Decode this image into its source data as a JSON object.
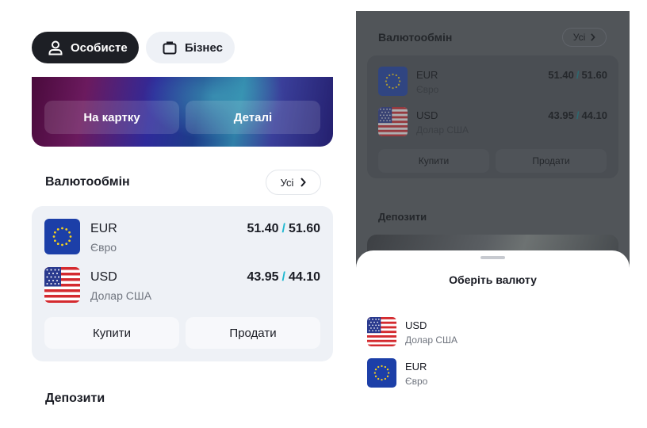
{
  "segments": {
    "personal_label": "Особисте",
    "business_label": "Бізнес"
  },
  "card": {
    "to_card_label": "На картку",
    "details_label": "Деталі"
  },
  "exchange": {
    "title": "Валютообмін",
    "all_label": "Усі",
    "currencies": [
      {
        "code": "EUR",
        "name": "Євро",
        "buy": "51.40",
        "sell": "51.60",
        "flag": "eu-flag"
      },
      {
        "code": "USD",
        "name": "Долар США",
        "buy": "43.95",
        "sell": "44.10",
        "flag": "us-flag"
      }
    ],
    "buy_label": "Купити",
    "sell_label": "Продати",
    "separator": "/"
  },
  "deposits": {
    "title": "Депозити"
  },
  "sheet": {
    "title": "Оберіть валюту",
    "options": [
      {
        "code": "USD",
        "name": "Долар США",
        "flag": "us-flag"
      },
      {
        "code": "EUR",
        "name": "Євро",
        "flag": "eu-flag"
      }
    ]
  },
  "colors": {
    "accent_slash": "#1fb8d0",
    "dark_pill": "#1d1f25",
    "light_pill": "#eef1f6"
  }
}
